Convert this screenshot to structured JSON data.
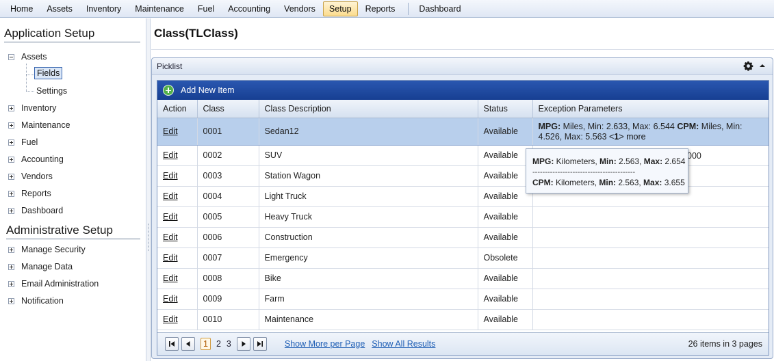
{
  "menu": {
    "items": [
      {
        "label": "Home",
        "active": false
      },
      {
        "label": "Assets",
        "active": false
      },
      {
        "label": "Inventory",
        "active": false
      },
      {
        "label": "Maintenance",
        "active": false
      },
      {
        "label": "Fuel",
        "active": false
      },
      {
        "label": "Accounting",
        "active": false
      },
      {
        "label": "Vendors",
        "active": false
      },
      {
        "label": "Setup",
        "active": true
      },
      {
        "label": "Reports",
        "active": false
      }
    ],
    "dashboard": "Dashboard"
  },
  "sidebar": {
    "app_setup_title": "Application Setup",
    "assets": "Assets",
    "fields": "Fields",
    "settings": "Settings",
    "inventory": "Inventory",
    "maintenance": "Maintenance",
    "fuel": "Fuel",
    "accounting": "Accounting",
    "vendors": "Vendors",
    "reports": "Reports",
    "dashboard": "Dashboard",
    "admin_setup_title": "Administrative Setup",
    "manage_security": "Manage Security",
    "manage_data": "Manage Data",
    "email_administration": "Email Administration",
    "notification": "Notification"
  },
  "page": {
    "title": "Class(TLClass)"
  },
  "picklist": {
    "header": "Picklist",
    "add_new_item": "Add New Item",
    "columns": {
      "action": "Action",
      "class": "Class",
      "description": "Class Description",
      "status": "Status",
      "exception": "Exception Parameters"
    },
    "rows": [
      {
        "action": "Edit",
        "class": "0001",
        "description": "Sedan12",
        "status": "Available"
      },
      {
        "action": "Edit",
        "class": "0002",
        "description": "SUV",
        "status": "Available"
      },
      {
        "action": "Edit",
        "class": "0003",
        "description": "Station Wagon",
        "status": "Available"
      },
      {
        "action": "Edit",
        "class": "0004",
        "description": "Light Truck",
        "status": "Available"
      },
      {
        "action": "Edit",
        "class": "0005",
        "description": "Heavy Truck",
        "status": "Available"
      },
      {
        "action": "Edit",
        "class": "0006",
        "description": "Construction",
        "status": "Available"
      },
      {
        "action": "Edit",
        "class": "0007",
        "description": "Emergency",
        "status": "Obsolete"
      },
      {
        "action": "Edit",
        "class": "0008",
        "description": "Bike",
        "status": "Available"
      },
      {
        "action": "Edit",
        "class": "0009",
        "description": "Farm",
        "status": "Available"
      },
      {
        "action": "Edit",
        "class": "0010",
        "description": "Maintenance",
        "status": "Available"
      }
    ],
    "row1_exception": {
      "mpg_label": "MPG:",
      "mpg_text": " Miles, Min: 2.633, Max: 6.544 ",
      "cpm_label": "CPM:",
      "cpm_text": " Miles, Min: 4.526, Max: 5.563 ",
      "count_open": "<",
      "count": "1",
      "count_close": ">",
      "more": " more"
    },
    "row2_exception_partial": "000",
    "tooltip": {
      "mpg_label": "MPG:",
      "mpg_unit": " Kilometers, ",
      "min_label": "Min:",
      "mpg_min": " 2.563, ",
      "max_label": "Max:",
      "mpg_max": " 2.654",
      "separator": "-----------------------------------------",
      "cpm_label": "CPM:",
      "cpm_unit": " Kilometers, ",
      "cpm_min": " 2.563, ",
      "cpm_max": " 3.655"
    },
    "pager": {
      "pages": [
        "1",
        "2",
        "3"
      ],
      "current": "1",
      "show_more": "Show More per Page",
      "show_all": "Show All Results",
      "summary": "26 items in 3 pages"
    }
  }
}
